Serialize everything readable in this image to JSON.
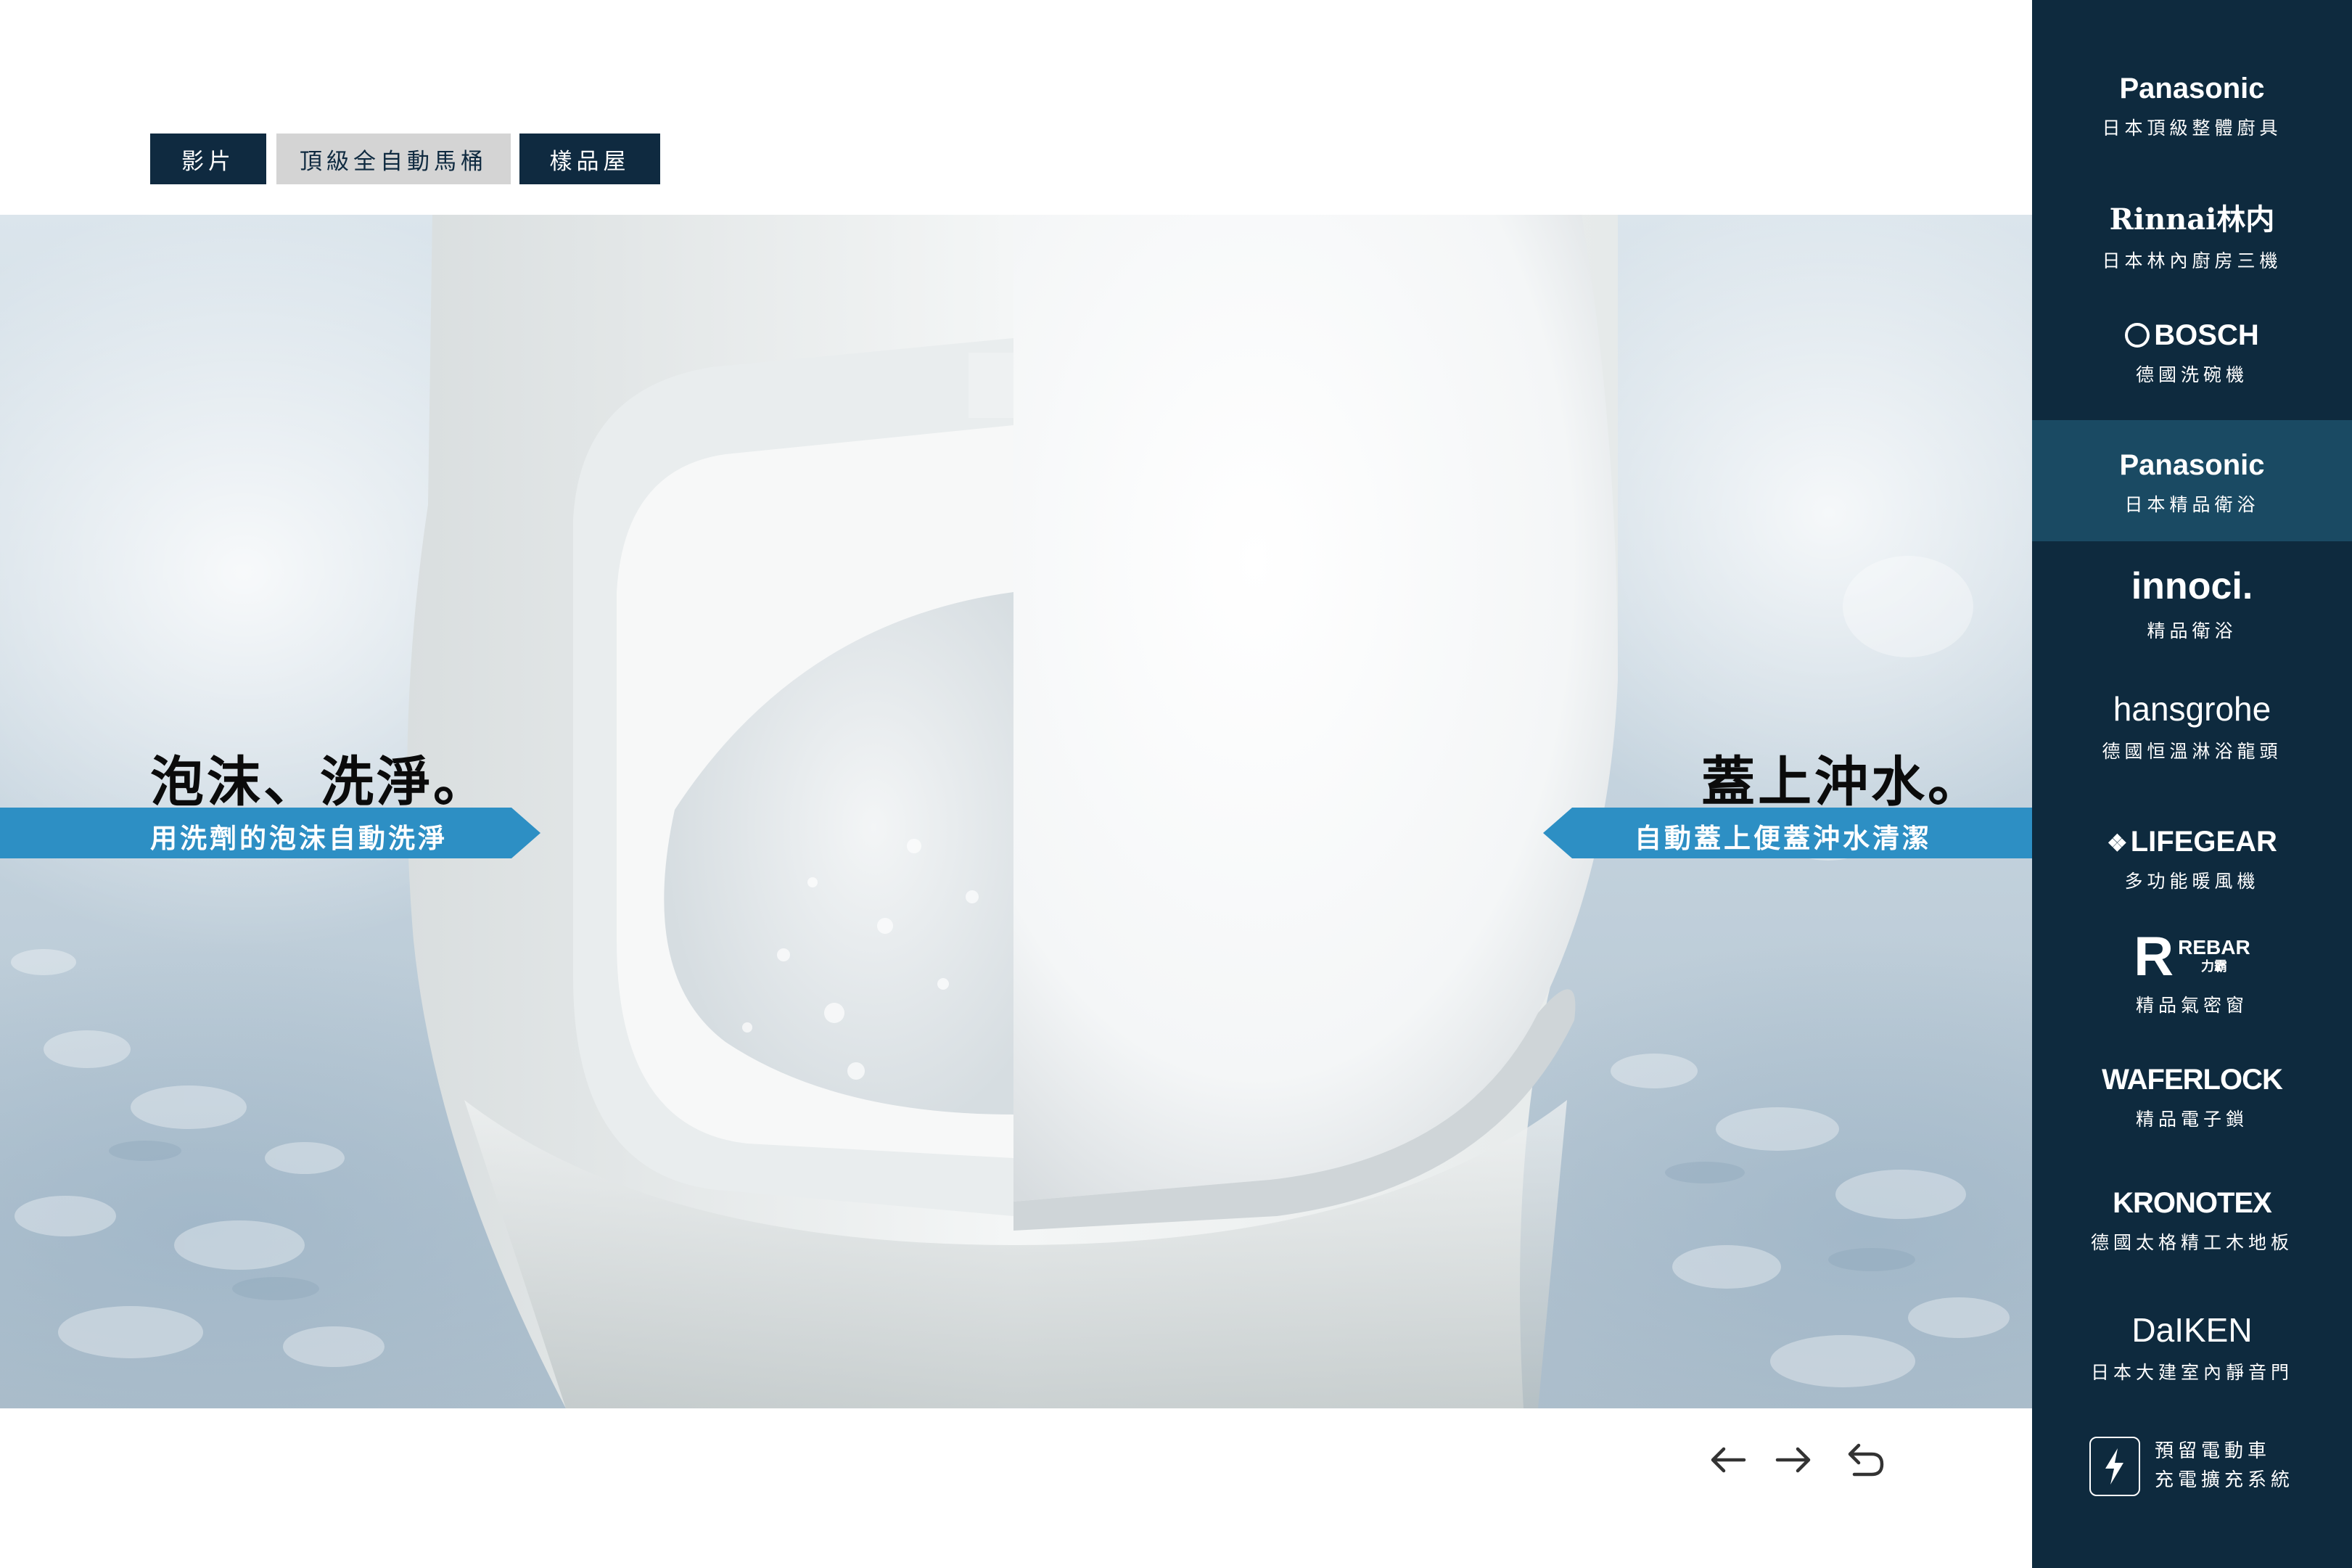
{
  "tabs": [
    {
      "label": "影片"
    },
    {
      "label": "頂級全自動馬桶"
    },
    {
      "label": "樣品屋"
    }
  ],
  "hero": {
    "left_headline": "泡沫、洗淨。",
    "left_banner": "用洗劑的泡沫自動洗淨",
    "right_headline": "蓋上沖水。",
    "right_banner": "自動蓋上便蓋沖水清潔",
    "banner_color": "#2d8fc4"
  },
  "nav": {
    "prev_icon": "arrow-left-icon",
    "next_icon": "arrow-right-icon",
    "back_icon": "return-icon"
  },
  "sidebar": {
    "background": "#0e2a3e",
    "active_color": "#1a4a63",
    "brands": [
      {
        "name": "Panasonic",
        "sub": "日本頂級整體廚具"
      },
      {
        "name": "Rinnai林内",
        "sub": "日本林內廚房三機"
      },
      {
        "name": "BOSCH",
        "sub": "德國洗碗機"
      },
      {
        "name": "Panasonic",
        "sub": "日本精品衛浴",
        "active": true
      },
      {
        "name": "innoci.",
        "sub": "精品衛浴"
      },
      {
        "name": "hansgrohe",
        "sub": "德國恒溫淋浴龍頭"
      },
      {
        "name": "LIFEGEAR",
        "sub": "多功能暖風機"
      },
      {
        "name": "REBAR",
        "name_small": "力霸",
        "sub": "精品氣密窗"
      },
      {
        "name": "WAFERLOCK",
        "sub": "精品電子鎖"
      },
      {
        "name": "KRONOTEX",
        "sub": "德國太格精工木地板"
      },
      {
        "name": "DaIKEN",
        "sub": "日本大建室內靜音門"
      }
    ],
    "ev": {
      "line1": "預留電動車",
      "line2": "充電擴充系統",
      "icon": "lightning-icon"
    }
  }
}
